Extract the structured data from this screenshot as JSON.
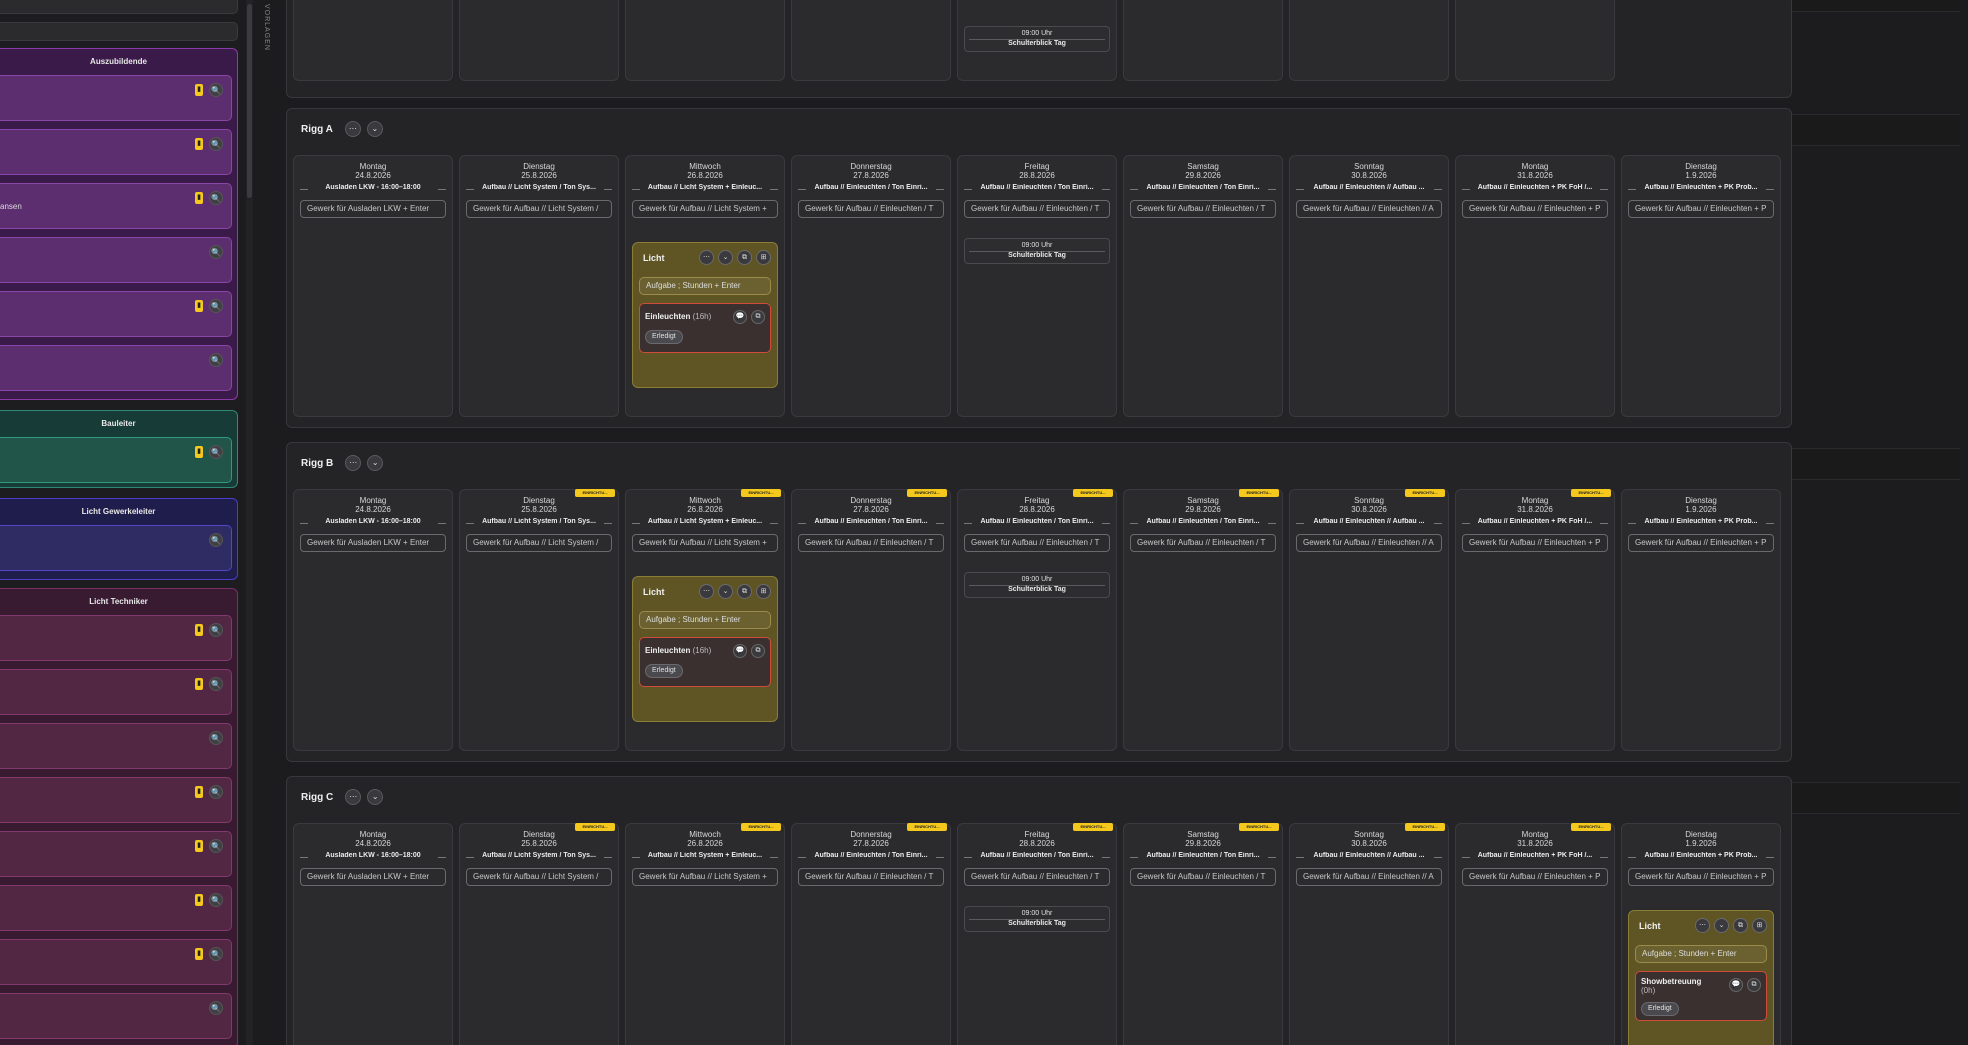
{
  "sidebar": {
    "groups": [
      {
        "title": "Auszubildende",
        "cards": [
          {
            "text": "",
            "pin": true
          },
          {
            "text": "",
            "pin": true
          },
          {
            "text": "ansen",
            "pin": true
          },
          {
            "text": "",
            "pin": false
          },
          {
            "text": "",
            "pin": true
          },
          {
            "text": "",
            "pin": false
          }
        ]
      },
      {
        "title": "Bauleiter",
        "cards": [
          {
            "text": "",
            "pin": true
          }
        ]
      },
      {
        "title": "Licht Gewerkeleiter",
        "cards": [
          {
            "text": "",
            "pin": false
          }
        ]
      },
      {
        "title": "Licht Techniker",
        "cards": [
          {
            "text": "",
            "pin": true
          },
          {
            "text": "",
            "pin": true
          },
          {
            "text": "",
            "pin": false
          },
          {
            "text": "",
            "pin": true
          },
          {
            "text": "",
            "pin": true
          },
          {
            "text": "",
            "pin": true
          },
          {
            "text": "",
            "pin": true
          },
          {
            "text": "",
            "pin": false
          }
        ]
      }
    ]
  },
  "vertical_label": "VORLAGEN",
  "icons": {
    "pin": "pin-icon",
    "search": "search-icon",
    "more": "more-icon",
    "chevron": "chevron-down-icon",
    "copy": "copy-icon",
    "comment": "comment-icon",
    "grid": "grid-icon"
  },
  "glyphs": {
    "search": "🔍",
    "more": "⋯",
    "chevron": "⌄",
    "copy": "⧉",
    "comment": "💬",
    "grid": "⊞",
    "pin": "▮"
  },
  "badge_text": "EINRICHTU...",
  "event": {
    "time": "09:00 Uhr",
    "name": "Schulterblick Tag"
  },
  "licht": {
    "title": "Licht",
    "input_placeholder": "Aufgabe ; Stunden + Enter",
    "done_label": "Erledigt"
  },
  "days": [
    {
      "weekday": "Montag",
      "date": "24.8.2026",
      "label": "Ausladen LKW - 16:00–18:00",
      "input": "Gewerk für Ausladen LKW + Enter"
    },
    {
      "weekday": "Dienstag",
      "date": "25.8.2026",
      "label": "Aufbau // Licht System / Ton Sys...",
      "input": "Gewerk für Aufbau // Licht System /"
    },
    {
      "weekday": "Mittwoch",
      "date": "26.8.2026",
      "label": "Aufbau // Licht System + Einleuc...",
      "input": "Gewerk für Aufbau // Licht System +"
    },
    {
      "weekday": "Donnerstag",
      "date": "27.8.2026",
      "label": "Aufbau // Einleuchten / Ton Einri...",
      "input": "Gewerk für Aufbau // Einleuchten / T"
    },
    {
      "weekday": "Freitag",
      "date": "28.8.2026",
      "label": "Aufbau // Einleuchten / Ton Einri...",
      "input": "Gewerk für Aufbau // Einleuchten / T"
    },
    {
      "weekday": "Samstag",
      "date": "29.8.2026",
      "label": "Aufbau // Einleuchten / Ton Einri...",
      "input": "Gewerk für Aufbau // Einleuchten / T"
    },
    {
      "weekday": "Sonntag",
      "date": "30.8.2026",
      "label": "Aufbau // Einleuchten // Aufbau ...",
      "input": "Gewerk für Aufbau // Einleuchten // A"
    },
    {
      "weekday": "Montag",
      "date": "31.8.2026",
      "label": "Aufbau // Einleuchten + PK FoH /...",
      "input": "Gewerk für Aufbau // Einleuchten + P"
    },
    {
      "weekday": "Dienstag",
      "date": "1.9.2026",
      "label": "Aufbau // Einleuchten + PK Prob...",
      "input": "Gewerk für Aufbau // Einleuchten + P"
    }
  ],
  "riggs": [
    {
      "name": "Rigg A",
      "badges": [
        false,
        false,
        false,
        false,
        false,
        false,
        false,
        false,
        false
      ],
      "licht_day": 2,
      "task": {
        "name": "Einleuchten",
        "hours": "(16h)"
      }
    },
    {
      "name": "Rigg B",
      "badges": [
        false,
        true,
        true,
        true,
        true,
        true,
        true,
        true,
        false
      ],
      "licht_day": 2,
      "task": {
        "name": "Einleuchten",
        "hours": "(16h)"
      }
    },
    {
      "name": "Rigg C",
      "badges": [
        false,
        true,
        true,
        true,
        true,
        true,
        true,
        true,
        false
      ],
      "licht_day": 8,
      "task": {
        "name": "Showbetreuung",
        "hours": "(0h)"
      }
    }
  ]
}
